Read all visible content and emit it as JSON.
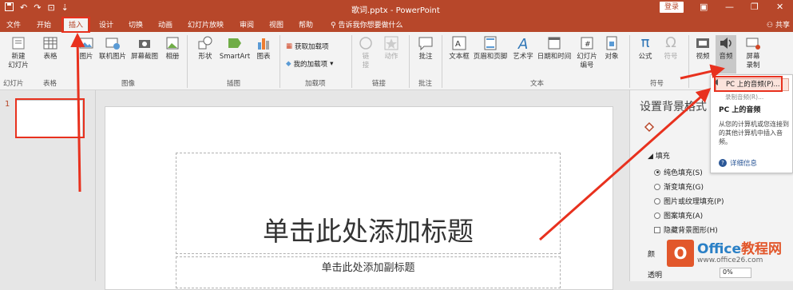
{
  "titlebar": {
    "doc_title": "歌词.pptx  -  PowerPoint",
    "login_label": "登录",
    "qa_save_icon": "save-icon",
    "qa_undo": "↶",
    "qa_redo": "↷",
    "qa_touch": "⊡",
    "qa_customize": "⇣",
    "win_min": "—",
    "win_restore": "❐",
    "win_close": "✕",
    "ribbon_display": "▣"
  },
  "tabs": {
    "items": [
      "文件",
      "开始",
      "插入",
      "设计",
      "切换",
      "动画",
      "幻灯片放映",
      "审阅",
      "视图",
      "帮助"
    ],
    "active": "插入",
    "tellme": "告诉我你想要做什么",
    "share": "共享"
  },
  "ribbon": {
    "new_slide": "新建\n幻灯片",
    "table": "表格",
    "pictures": "图片",
    "online_pictures": "联机图片",
    "screenshot": "屏幕截图",
    "album": "相册",
    "shapes": "形状",
    "smartart": "SmartArt",
    "chart": "图表",
    "get_addins": "获取加载项",
    "my_addins": "我的加载项",
    "link": "链\n接",
    "action": "动作",
    "comment": "批注",
    "textbox": "文本框",
    "header_footer": "页眉和页脚",
    "wordart": "艺术字",
    "datetime": "日期和时间",
    "slide_number": "幻灯片\n编号",
    "object": "对象",
    "equation": "公式",
    "symbol": "符号",
    "video": "视频",
    "audio": "音频",
    "screen_recording": "屏幕\n录制",
    "groups": {
      "slides": "幻灯片",
      "tables": "表格",
      "images": "图像",
      "illustrations": "插图",
      "addins": "加载项",
      "links": "链接",
      "comments": "批注",
      "text": "文本",
      "symbols": "符号"
    }
  },
  "thumbs": {
    "number": "1"
  },
  "slide": {
    "title_placeholder": "单击此处添加标题",
    "subtitle_placeholder": "单击此处添加副标题"
  },
  "pane": {
    "title": "设置背景格式",
    "section": "填充",
    "options": [
      "纯色填充(S)",
      "渐变填充(G)",
      "图片或纹理填充(P)",
      "图案填充(A)"
    ],
    "hide_bg": "隐藏背景图形(H)",
    "partial_1": "颜",
    "partial_2": "透明",
    "partial_3": "0%"
  },
  "dropdown": {
    "item": "PC 上的音频(P)...",
    "partial_under": "录制音频(R)...",
    "tip_title": "PC 上的音频",
    "tip_body": "从您的计算机或您连接到的其他计算机中插入音频。",
    "tip_link": "详细信息"
  },
  "watermark": {
    "logo": "O",
    "brand": "Office",
    "brand_tail": "教程网",
    "url": "www.office26.com"
  },
  "colors": {
    "accent": "#b7472a",
    "annotation": "#e8311e",
    "link": "#2b5797"
  }
}
